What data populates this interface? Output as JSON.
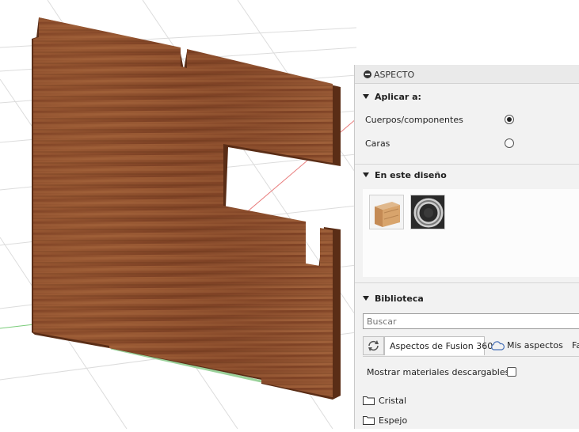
{
  "panel": {
    "title": "ASPECTO",
    "apply": {
      "header": "Aplicar a:",
      "options": [
        {
          "label": "Cuerpos/componentes",
          "selected": true
        },
        {
          "label": "Caras",
          "selected": false
        }
      ]
    },
    "design": {
      "header": "En este diseño",
      "materials": [
        {
          "icon": "wood-material-swatch"
        },
        {
          "icon": "chrome-material-swatch"
        }
      ]
    },
    "library": {
      "header": "Biblioteca",
      "search_placeholder": "Buscar",
      "tabs": [
        {
          "label": "Aspectos de Fusion 360",
          "active": true
        },
        {
          "label": "Mis aspectos",
          "icon": "cloud-icon"
        },
        {
          "label": "Fa"
        }
      ],
      "download_label": "Mostrar materiales descargables",
      "download_checked": false,
      "folders": [
        "Cristal",
        "Espejo"
      ]
    }
  },
  "colors": {
    "panel_bg": "#f2f2f2",
    "wood": "#8a4a2a",
    "grid": "#d9d9d9",
    "axis_red": "#e87a7a",
    "axis_green": "#7acc7a"
  }
}
